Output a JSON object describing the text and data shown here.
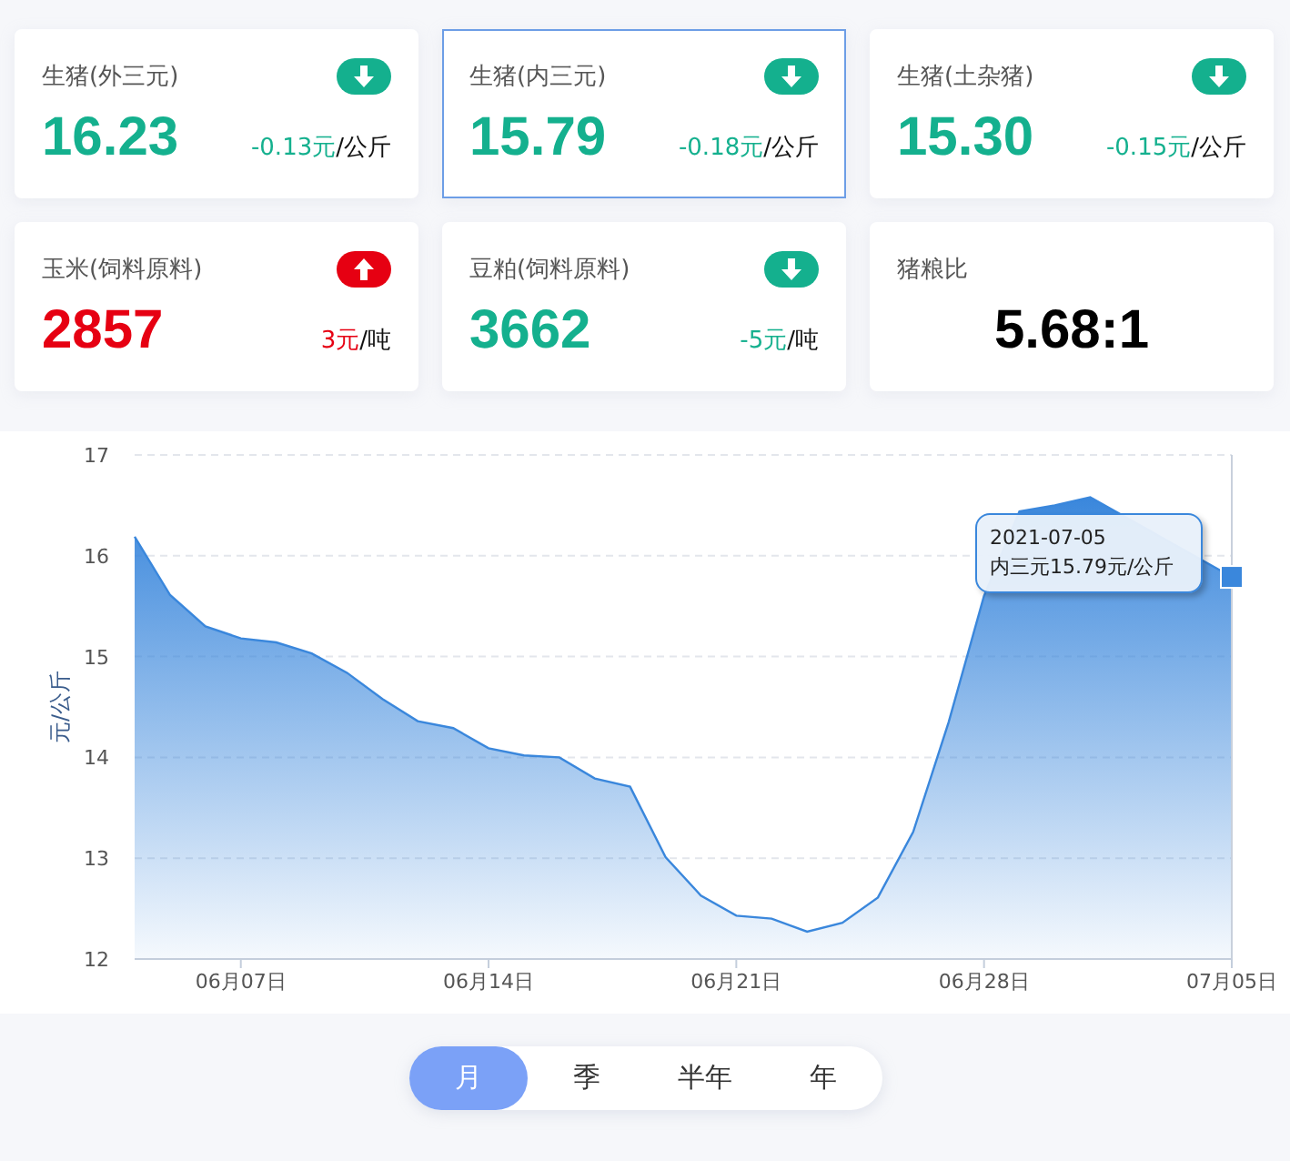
{
  "cards": [
    {
      "title": "生猪(外三元)",
      "value": "16.23",
      "change": "-0.13元",
      "unit": "/公斤",
      "kind": "down",
      "selected": false
    },
    {
      "title": "生猪(内三元)",
      "value": "15.79",
      "change": "-0.18元",
      "unit": "/公斤",
      "kind": "down",
      "selected": true
    },
    {
      "title": "生猪(土杂猪)",
      "value": "15.30",
      "change": "-0.15元",
      "unit": "/公斤",
      "kind": "down",
      "selected": false
    },
    {
      "title": "玉米(饲料原料)",
      "value": "2857",
      "change": "3元",
      "unit": "/吨",
      "kind": "up",
      "selected": false
    },
    {
      "title": "豆粕(饲料原料)",
      "value": "3662",
      "change": "-5元",
      "unit": "/吨",
      "kind": "down",
      "selected": false
    },
    {
      "title": "猪粮比",
      "value": "5.68:1",
      "kind": "ratio",
      "selected": false
    }
  ],
  "chart": {
    "tooltip": {
      "date": "2021-07-05",
      "value": "15.79元/公斤"
    },
    "chart_data": {
      "type": "area",
      "ylabel": "元/公斤",
      "categories": [
        null,
        null,
        null,
        "06月07日",
        null,
        null,
        null,
        null,
        null,
        null,
        "06月14日",
        null,
        null,
        null,
        null,
        null,
        null,
        "06月21日",
        null,
        null,
        null,
        null,
        null,
        null,
        "06月28日",
        null,
        null,
        null,
        null,
        null,
        null,
        "07月05日"
      ],
      "series": [
        {
          "name": "内三元",
          "color": "#3a87dc",
          "values": [
            16.19,
            15.61,
            15.3,
            15.18,
            15.14,
            15.03,
            14.84,
            14.58,
            14.36,
            14.29,
            14.09,
            14.02,
            14.0,
            13.79,
            13.71,
            13.01,
            12.63,
            12.43,
            12.4,
            12.27,
            12.36,
            12.61,
            13.26,
            14.35,
            15.6,
            16.44,
            16.5,
            16.58,
            null,
            null,
            null,
            15.79
          ]
        }
      ],
      "ylim": [
        12,
        17
      ],
      "yticks": [
        12,
        13,
        14,
        15,
        16,
        17
      ],
      "grid": true
    }
  },
  "periods": [
    {
      "label": "月",
      "selected": true
    },
    {
      "label": "季",
      "selected": false
    },
    {
      "label": "半年",
      "selected": false
    },
    {
      "label": "年",
      "selected": false
    }
  ]
}
